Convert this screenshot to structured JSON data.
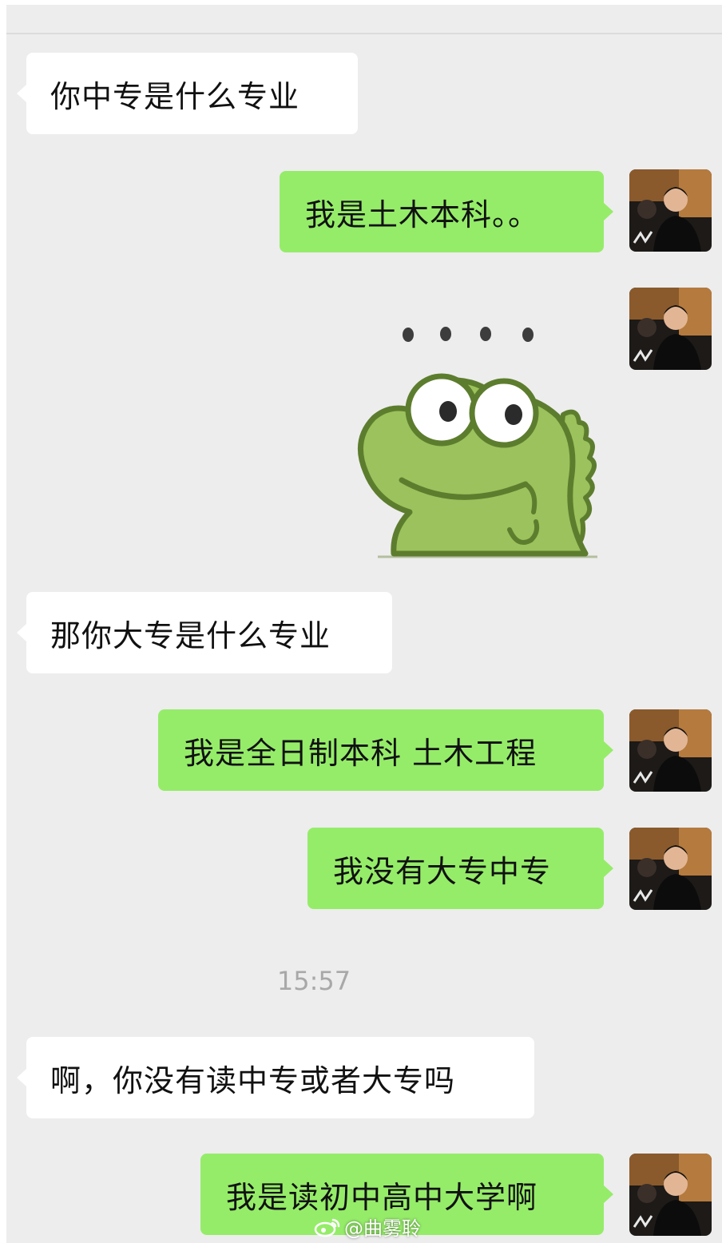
{
  "chat": {
    "messages": [
      {
        "side": "received",
        "text": "你中专是什么专业"
      },
      {
        "side": "sent",
        "text": "我是土木本科。。"
      },
      {
        "side": "sent",
        "type": "sticker",
        "sticker": "frog-dinosaur-ellipsis"
      },
      {
        "side": "received",
        "text": "那你大专是什么专业"
      },
      {
        "side": "sent",
        "text": "我是全日制本科 土木工程"
      },
      {
        "side": "sent",
        "text": "我没有大专中专"
      },
      {
        "side": "received",
        "text": "啊，你没有读中专或者大专吗"
      },
      {
        "side": "sent",
        "text": "我是读初中高中大学啊"
      }
    ],
    "timestamp": "15:57"
  },
  "watermark": {
    "text": "@曲雾聆",
    "icon": "weibo-icon"
  },
  "colors": {
    "background": "#ededed",
    "sent_bubble": "#95ec69",
    "received_bubble": "#ffffff",
    "timestamp": "#a8a8a8"
  }
}
